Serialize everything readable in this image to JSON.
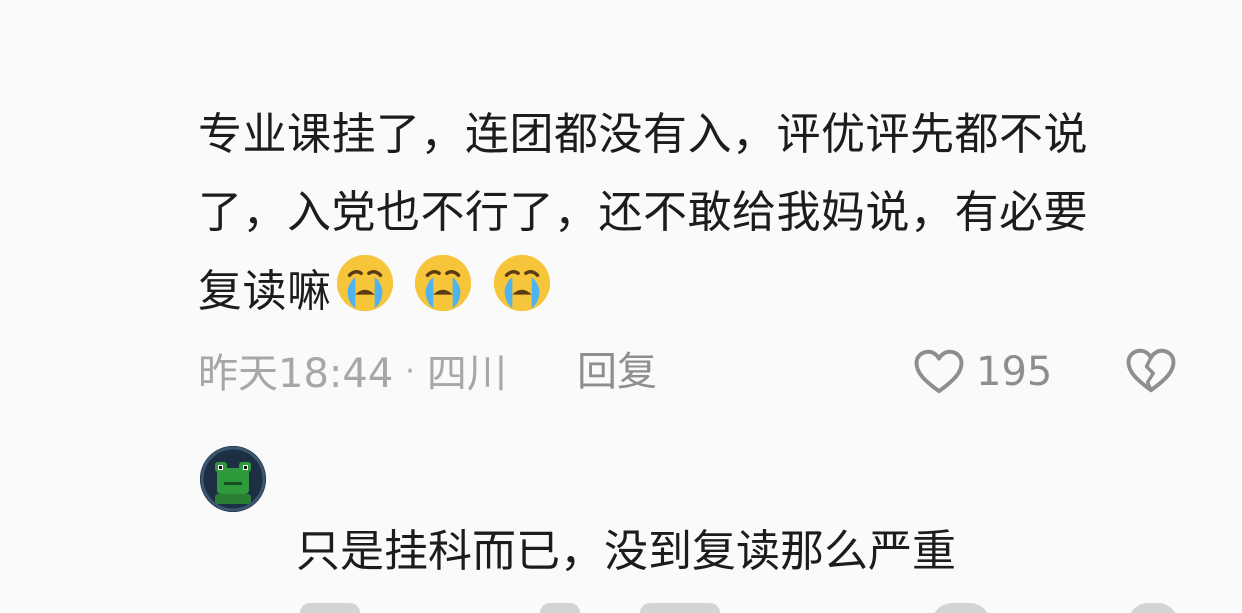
{
  "comment": {
    "text_line_1": "专业课挂了，连团都没有入，评优评先都不说",
    "text_line_2": "了，入党也不行了，还不敢给我妈说，有必要",
    "text_line_3": "复读嘛",
    "emojis": [
      "crying-face-emoji",
      "crying-face-emoji",
      "crying-face-emoji"
    ],
    "time": "昨天18:44",
    "separator": "·",
    "location": "四川",
    "reply_label": "回复",
    "like_count": "195"
  },
  "reply": {
    "avatar": "green-frog-avatar",
    "text": "只是挂科而已，没到复读那么严重"
  },
  "colors": {
    "text": "#1c1c1c",
    "meta": "#a7a7a7",
    "icon": "#8e8e8e",
    "emoji_face": "#f6c53a",
    "emoji_tears": "#4fb3f0"
  }
}
